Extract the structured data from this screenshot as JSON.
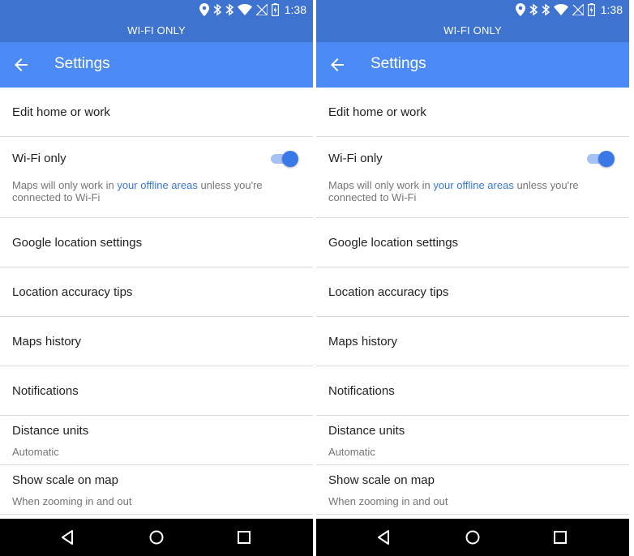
{
  "status": {
    "time": "1:38",
    "icons": [
      "location-icon",
      "bluetooth-icon",
      "bluetooth-icon",
      "wifi-icon",
      "no-signal-icon",
      "battery-icon"
    ]
  },
  "banner": "WI-FI ONLY",
  "appbar": {
    "title": "Settings"
  },
  "settings": {
    "edit_home": "Edit home or work",
    "wifi_only": {
      "label": "Wi-Fi only",
      "desc_pre": "Maps will only work in ",
      "desc_link": "your offline areas",
      "desc_post": " unless you're connected to Wi-Fi",
      "enabled": true
    },
    "google_location": "Google location settings",
    "accuracy_tips": "Location accuracy tips",
    "maps_history": "Maps history",
    "notifications": "Notifications",
    "distance_units": {
      "label": "Distance units",
      "value": "Automatic"
    },
    "show_scale": {
      "label": "Show scale on map",
      "value": "When zooming in and out"
    }
  },
  "colors": {
    "statusbar": "#3e74cf",
    "appbar": "#4c8bf5",
    "accent": "#3b78e7",
    "link": "#3b78d8"
  }
}
